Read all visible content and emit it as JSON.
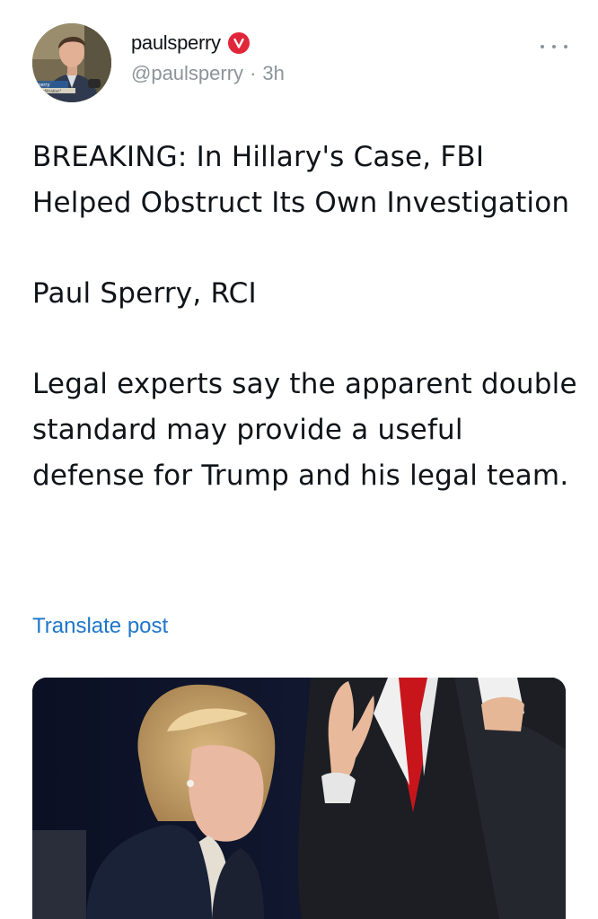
{
  "author": {
    "display_name": "paulsperry",
    "handle": "@paulsperry",
    "separator": "·",
    "time": "3h",
    "verified_icon": "verified-badge-icon",
    "badge_color": "#e2263a",
    "avatar_caption": "Sperry",
    "avatar_subcaption": "\"Infiltration\""
  },
  "post": {
    "paragraphs": [
      "BREAKING: In Hillary's Case, FBI Helped Obstruct Its Own Investigation",
      "Paul Sperry, RCI",
      "Legal experts say the apparent double standard may provide a useful defense for Trump and his legal team."
    ],
    "translate_label": "Translate post"
  },
  "more_icon": "more-options-icon",
  "colors": {
    "text": "#0f1419",
    "secondary": "#8b949a",
    "link": "#1d76c9"
  }
}
